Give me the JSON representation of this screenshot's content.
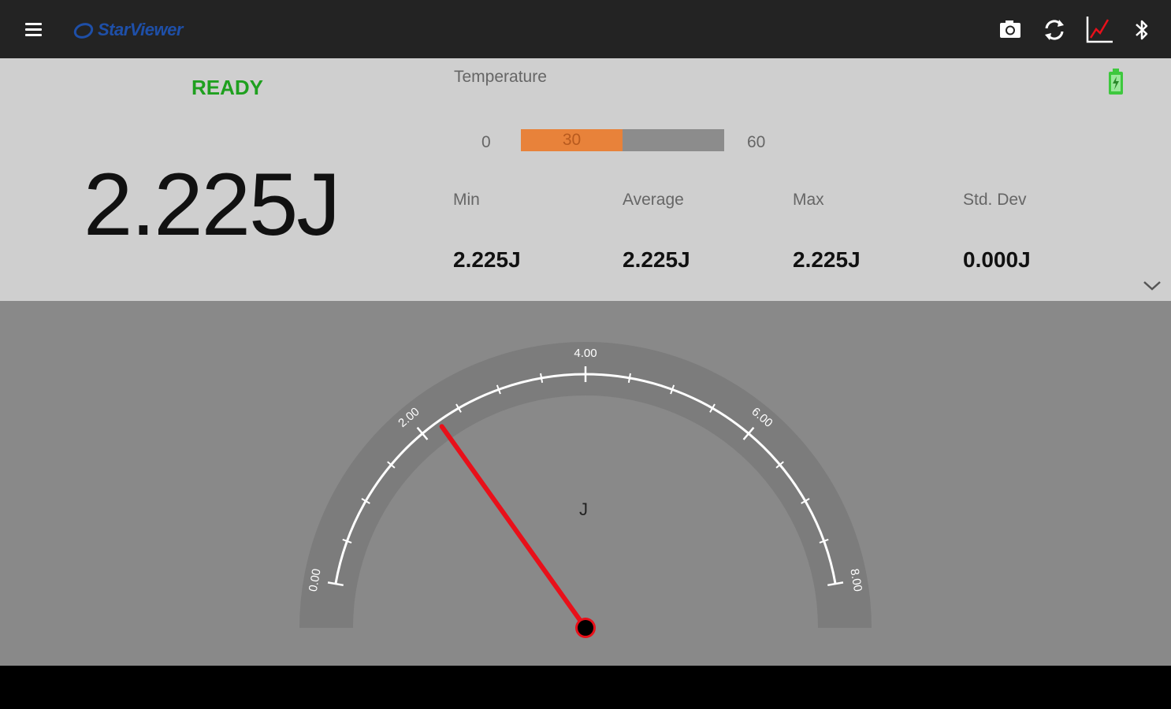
{
  "app": {
    "logo_text": "StarViewer",
    "brand_color": "#1e4fa8"
  },
  "toolbar": {
    "menu_icon": "hamburger-menu-icon",
    "icons": [
      "camera-icon",
      "refresh-icon",
      "chart-icon",
      "bluetooth-icon"
    ]
  },
  "status": {
    "text": "READY",
    "color": "#1fa01f"
  },
  "reading": {
    "value": "2.225J"
  },
  "temperature": {
    "label": "Temperature",
    "min_label": "0",
    "max_label": "60",
    "value": 30,
    "value_label": "30",
    "fill_fraction": 0.5,
    "fill_color": "#e8823a"
  },
  "battery": {
    "icon": "battery-icon",
    "color": "#3ec83e"
  },
  "stats": [
    {
      "label": "Min",
      "value": "2.225J"
    },
    {
      "label": "Average",
      "value": "2.225J"
    },
    {
      "label": "Max",
      "value": "2.225J"
    },
    {
      "label": "Std. Dev",
      "value": "0.000J"
    }
  ],
  "gauge": {
    "unit": "J",
    "min": 0,
    "max": 8,
    "value": 2.225,
    "major_ticks": [
      "0.00",
      "2.00",
      "4.00",
      "6.00",
      "8.00"
    ],
    "needle_color": "#e8101a"
  }
}
